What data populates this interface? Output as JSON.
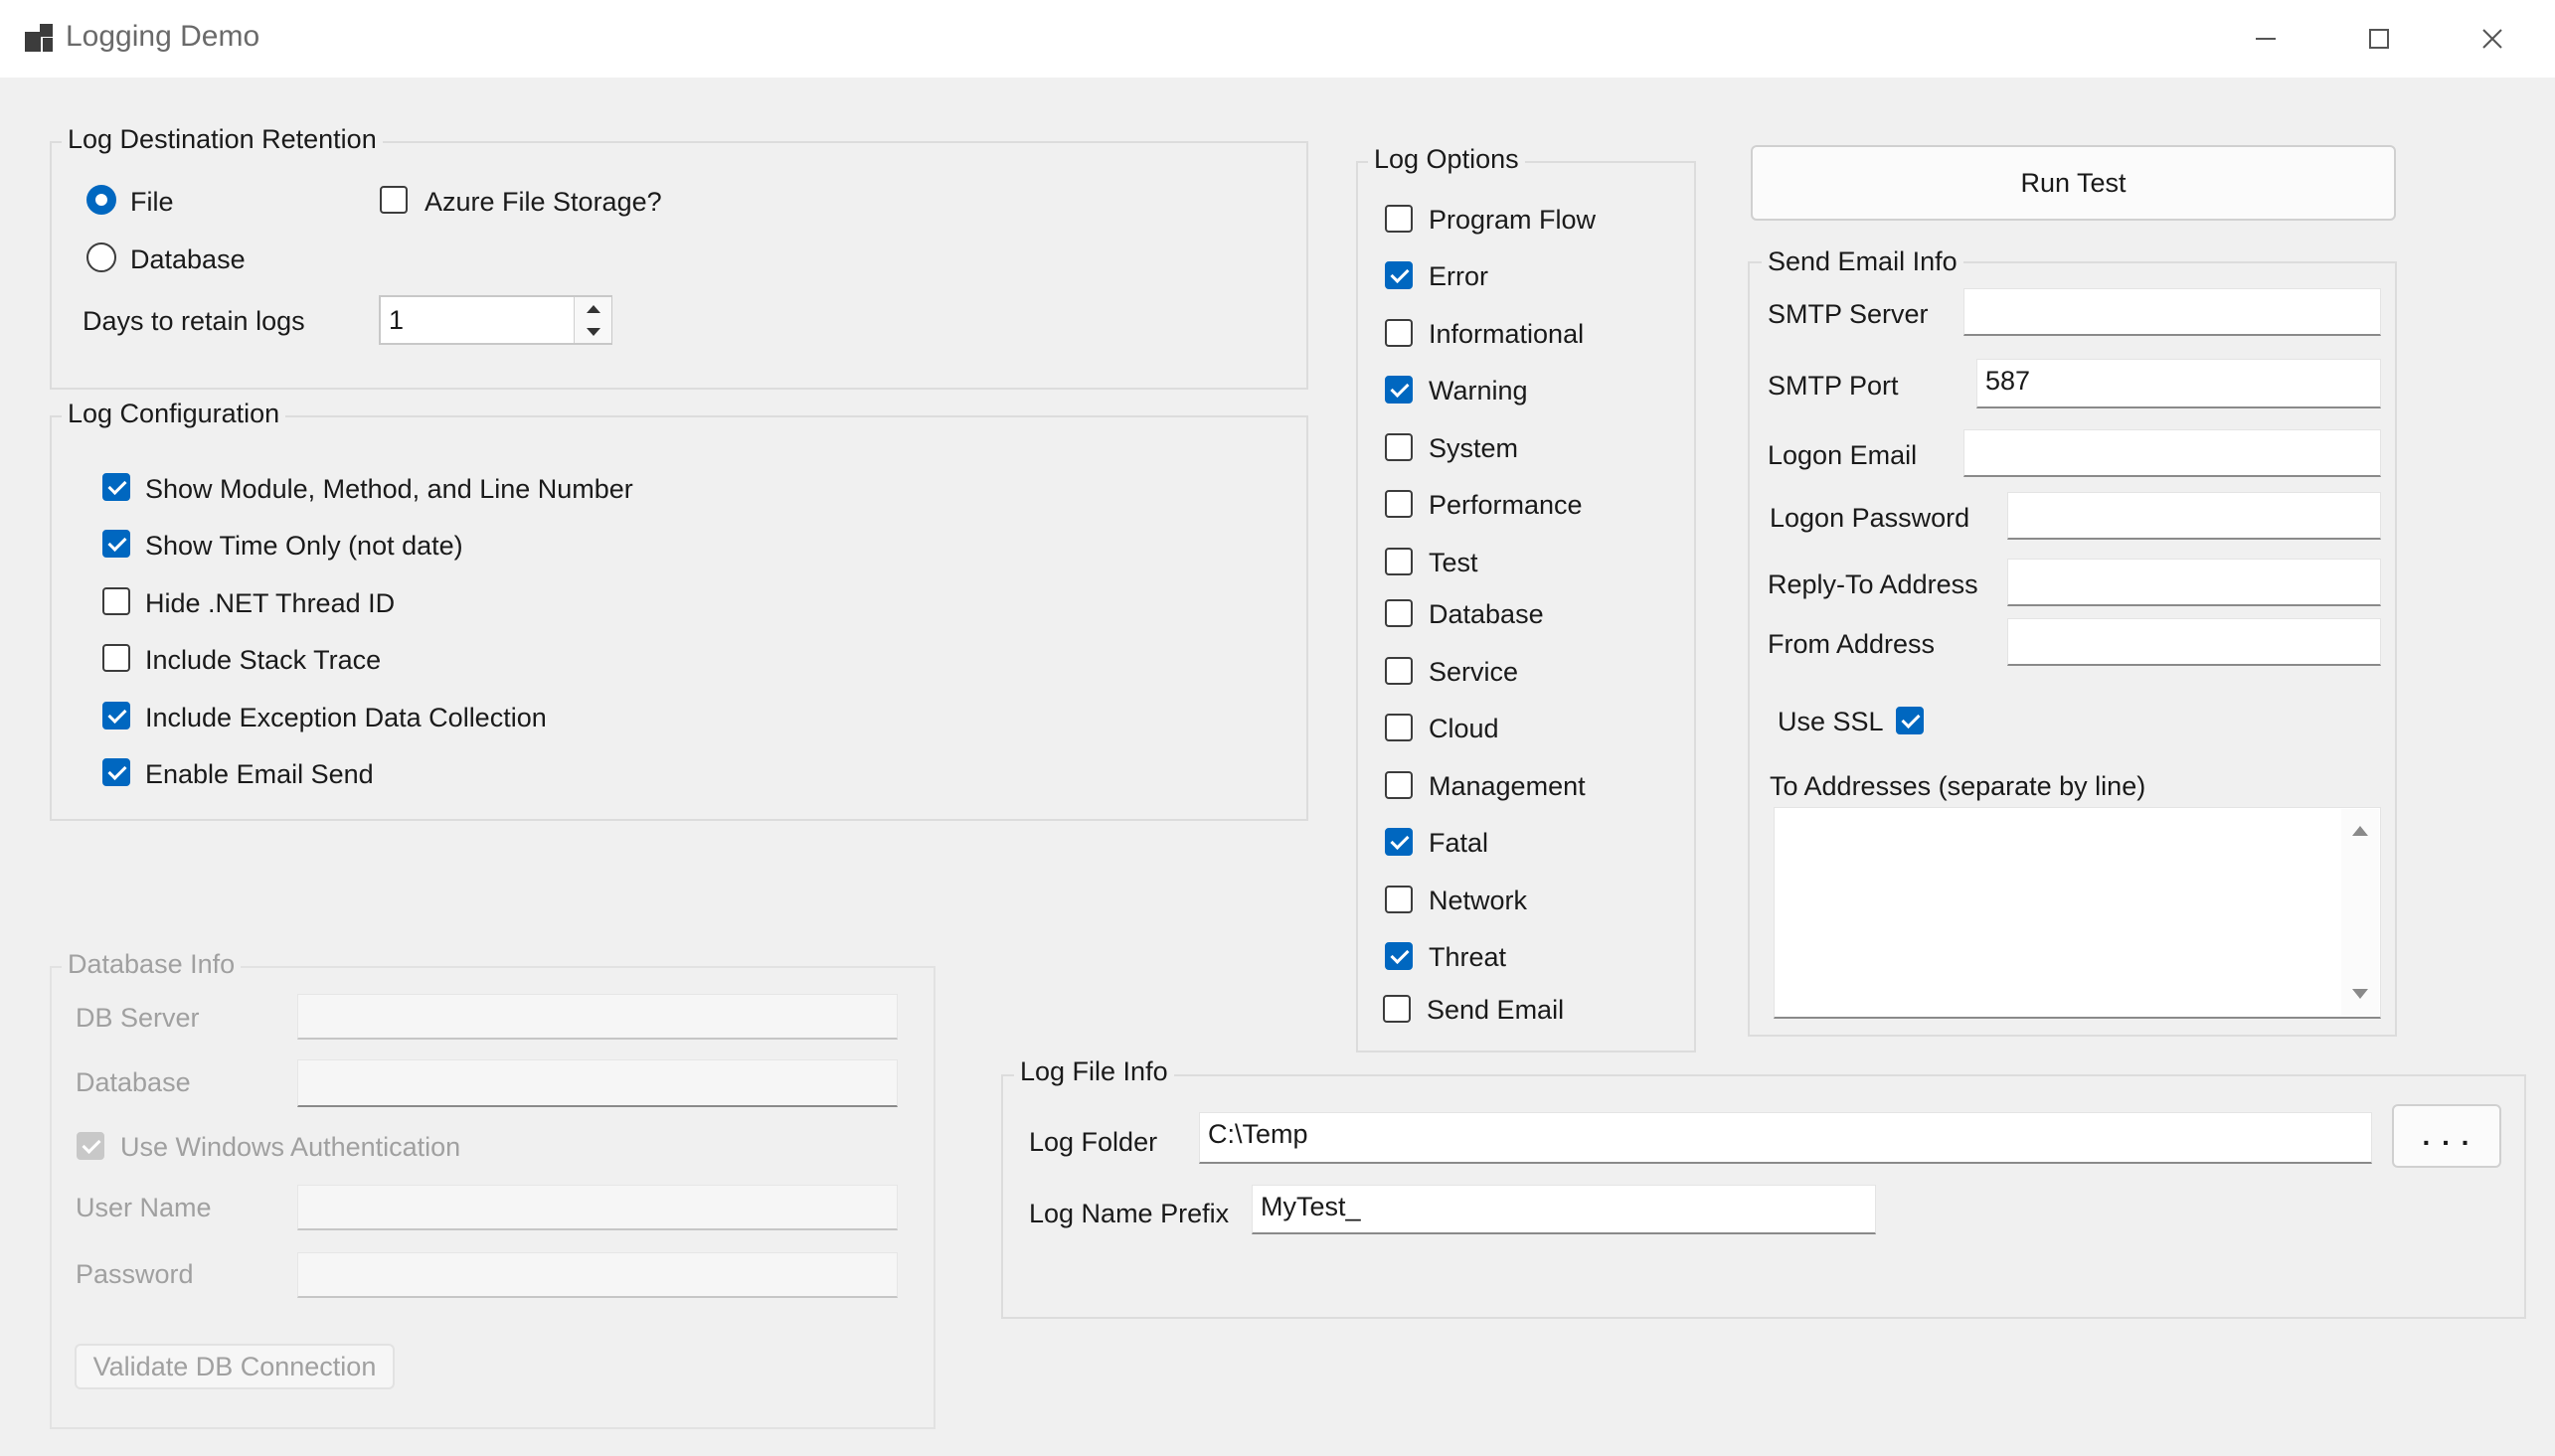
{
  "window": {
    "title": "Logging Demo"
  },
  "log_destination": {
    "legend": "Log Destination  Retention",
    "file_label": "File",
    "file_selected": true,
    "database_label": "Database",
    "database_selected": false,
    "azure_label": "Azure File Storage?",
    "azure_checked": false,
    "days_label": "Days to retain logs",
    "days_value": "1"
  },
  "log_configuration": {
    "legend": "Log Configuration",
    "options": [
      {
        "label": "Show Module, Method, and Line Number",
        "checked": true
      },
      {
        "label": "Show Time Only (not date)",
        "checked": true
      },
      {
        "label": "Hide .NET Thread ID",
        "checked": false
      },
      {
        "label": "Include Stack Trace",
        "checked": false
      },
      {
        "label": "Include Exception Data Collection",
        "checked": true
      },
      {
        "label": "Enable Email Send",
        "checked": true
      }
    ]
  },
  "database_info": {
    "legend": "Database Info",
    "db_server_label": "DB Server",
    "db_server_value": "",
    "database_label": "Database",
    "database_value": "",
    "windows_auth_label": "Use Windows Authentication",
    "windows_auth_checked": true,
    "user_name_label": "User Name",
    "user_name_value": "",
    "password_label": "Password",
    "password_value": "",
    "validate_button": "Validate DB Connection"
  },
  "log_options": {
    "legend": "Log Options",
    "items": [
      {
        "label": "Program Flow",
        "checked": false
      },
      {
        "label": "Error",
        "checked": true
      },
      {
        "label": "Informational",
        "checked": false
      },
      {
        "label": "Warning",
        "checked": true
      },
      {
        "label": "System",
        "checked": false
      },
      {
        "label": "Performance",
        "checked": false
      },
      {
        "label": "Test",
        "checked": false
      },
      {
        "label": "Database",
        "checked": false
      },
      {
        "label": "Service",
        "checked": false
      },
      {
        "label": "Cloud",
        "checked": false
      },
      {
        "label": "Management",
        "checked": false
      },
      {
        "label": "Fatal",
        "checked": true
      },
      {
        "label": "Network",
        "checked": false
      },
      {
        "label": "Threat",
        "checked": true
      },
      {
        "label": "Send Email",
        "checked": false
      }
    ]
  },
  "run_test_button": "Run Test",
  "send_email": {
    "legend": "Send Email Info",
    "smtp_server_label": "SMTP Server",
    "smtp_server_value": "",
    "smtp_port_label": "SMTP Port",
    "smtp_port_value": "587",
    "logon_email_label": "Logon Email",
    "logon_email_value": "",
    "logon_password_label": "Logon Password",
    "logon_password_value": "",
    "reply_to_label": "Reply-To Address",
    "reply_to_value": "",
    "from_label": "From Address",
    "from_value": "",
    "use_ssl_label": "Use SSL",
    "use_ssl_checked": true,
    "to_addresses_label": "To Addresses (separate by line)",
    "to_addresses_value": ""
  },
  "log_file_info": {
    "legend": "Log File Info",
    "folder_label": "Log Folder",
    "folder_value": "C:\\Temp",
    "browse_button": ". . .",
    "prefix_label": "Log Name Prefix",
    "prefix_value": "MyTest_"
  },
  "icons": {
    "app": "app-window-icon",
    "minimize": "minimize-icon",
    "maximize": "maximize-icon",
    "close": "close-icon",
    "scroll_up": "scroll-up-arrow-icon",
    "scroll_down": "scroll-down-arrow-icon",
    "spin_up": "spin-up-arrow-icon",
    "spin_down": "spin-down-arrow-icon"
  },
  "colors": {
    "accent": "#0067c0",
    "window_bg": "#f0f0f0",
    "titlebar_bg": "#ffffff",
    "disabled_text": "#a0a0a0"
  }
}
